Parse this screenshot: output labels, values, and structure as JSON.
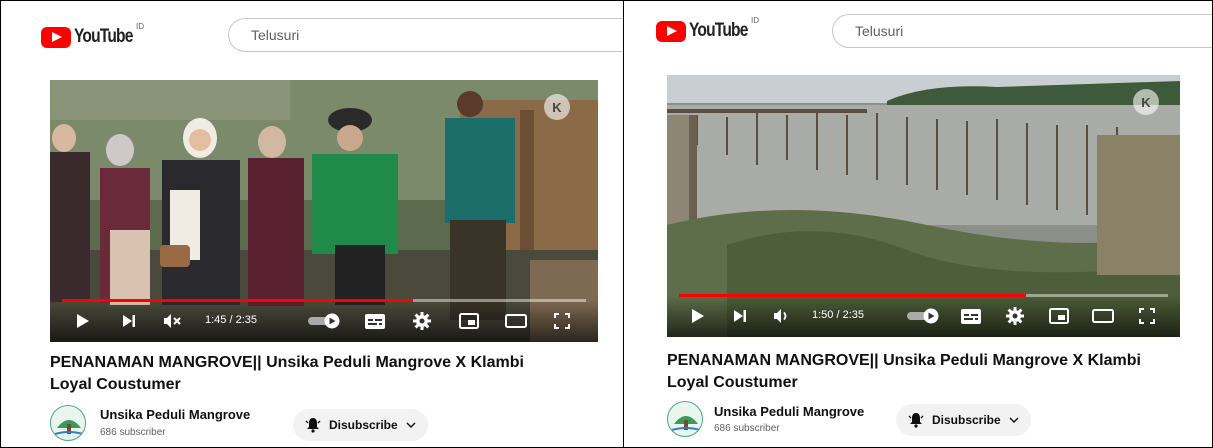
{
  "left": {
    "logo_text": "YouTube",
    "region": "ID",
    "search_placeholder": "Telusuri",
    "time": "1:45 / 2:35",
    "progress": 0.67,
    "title_line1": "PENANAMAN MANGROVE|| Unsika Peduli Mangrove X Klambi",
    "title_line2": "Loyal Coustumer",
    "channel_name": "Unsika Peduli Mangrove",
    "subscribers": "686 subscriber",
    "subscribe_label": "Disubscribe",
    "watermark": "K"
  },
  "right": {
    "logo_text": "YouTube",
    "region": "ID",
    "search_placeholder": "Telusuri",
    "time": "1:50 / 2:35",
    "progress": 0.71,
    "title_line1": "PENANAMAN MANGROVE|| Unsika Peduli Mangrove X Klambi",
    "title_line2": "Loyal Coustumer",
    "channel_name": "Unsika Peduli Mangrove",
    "subscribers": "686 subscriber",
    "subscribe_label": "Disubscribe",
    "watermark": "K"
  },
  "colors": {
    "youtube_red": "#ff0000",
    "progress_red": "#ff0000",
    "button_bg": "#f2f2f2"
  },
  "icons": [
    "play-icon",
    "next-icon",
    "mute-icon",
    "volume-icon",
    "autoplay-toggle-icon",
    "subtitles-icon",
    "settings-icon",
    "miniplayer-icon",
    "theater-icon",
    "fullscreen-icon",
    "bell-icon",
    "chevron-down-icon"
  ]
}
